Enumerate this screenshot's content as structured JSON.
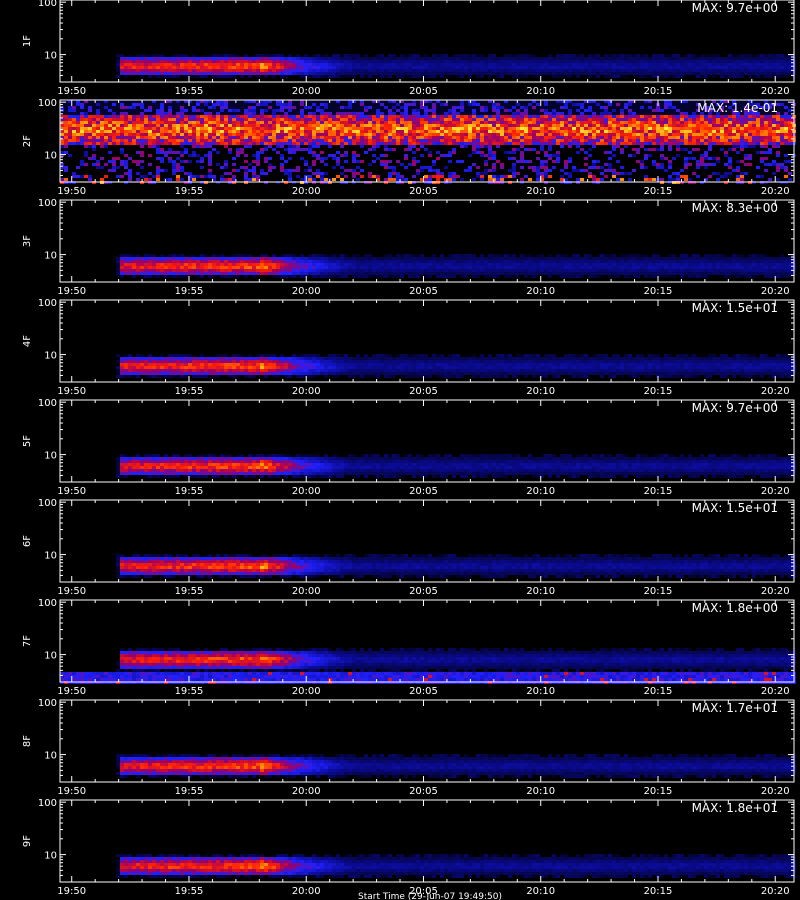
{
  "chart_data": {
    "type": "heatmap",
    "x_tick_labels": [
      "19:50",
      "19:55",
      "20:00",
      "20:05",
      "20:10",
      "20:15",
      "20:20"
    ],
    "y_tick_labels": [
      "100",
      "10"
    ],
    "y_scale": "log",
    "footer_label": "Start Time (29-Jun-07 19:49:50)",
    "colors": {
      "background": "#000000",
      "frame": "#ffffff",
      "colormap": [
        "#000000",
        "#0a0a90",
        "#2020ff",
        "#a00060",
        "#ff2000",
        "#ff9000",
        "#ffff40"
      ]
    },
    "panels": [
      {
        "label": "1F",
        "max_label": "MAX: 9.7e+00",
        "pattern": "band",
        "band_center_freq": 6,
        "peak_time": "19:58",
        "onset_time": "19:52"
      },
      {
        "label": "2F",
        "max_label": "MAX: 1.4e-01",
        "pattern": "noise",
        "band_center_freq": 30
      },
      {
        "label": "3F",
        "max_label": "MAX: 8.3e+00",
        "pattern": "band",
        "band_center_freq": 6,
        "peak_time": "19:58",
        "onset_time": "19:52"
      },
      {
        "label": "4F",
        "max_label": "MAX: 1.5e+01",
        "pattern": "band",
        "band_center_freq": 6,
        "peak_time": "19:58",
        "onset_time": "19:52"
      },
      {
        "label": "5F",
        "max_label": "MAX: 9.7e+00",
        "pattern": "band",
        "band_center_freq": 6,
        "peak_time": "19:58",
        "onset_time": "19:52"
      },
      {
        "label": "6F",
        "max_label": "MAX: 1.5e+01",
        "pattern": "band",
        "band_center_freq": 6,
        "peak_time": "19:58",
        "onset_time": "19:52"
      },
      {
        "label": "7F",
        "max_label": "MAX: 1.8e+00",
        "pattern": "band_low_noise",
        "band_center_freq": 8,
        "peak_time": "19:58",
        "onset_time": "19:52"
      },
      {
        "label": "8F",
        "max_label": "MAX: 1.7e+01",
        "pattern": "band",
        "band_center_freq": 6,
        "peak_time": "19:58",
        "onset_time": "19:52"
      },
      {
        "label": "9F",
        "max_label": "MAX: 1.8e+01",
        "pattern": "band",
        "band_center_freq": 6,
        "peak_time": "19:58",
        "onset_time": "19:52"
      }
    ]
  }
}
